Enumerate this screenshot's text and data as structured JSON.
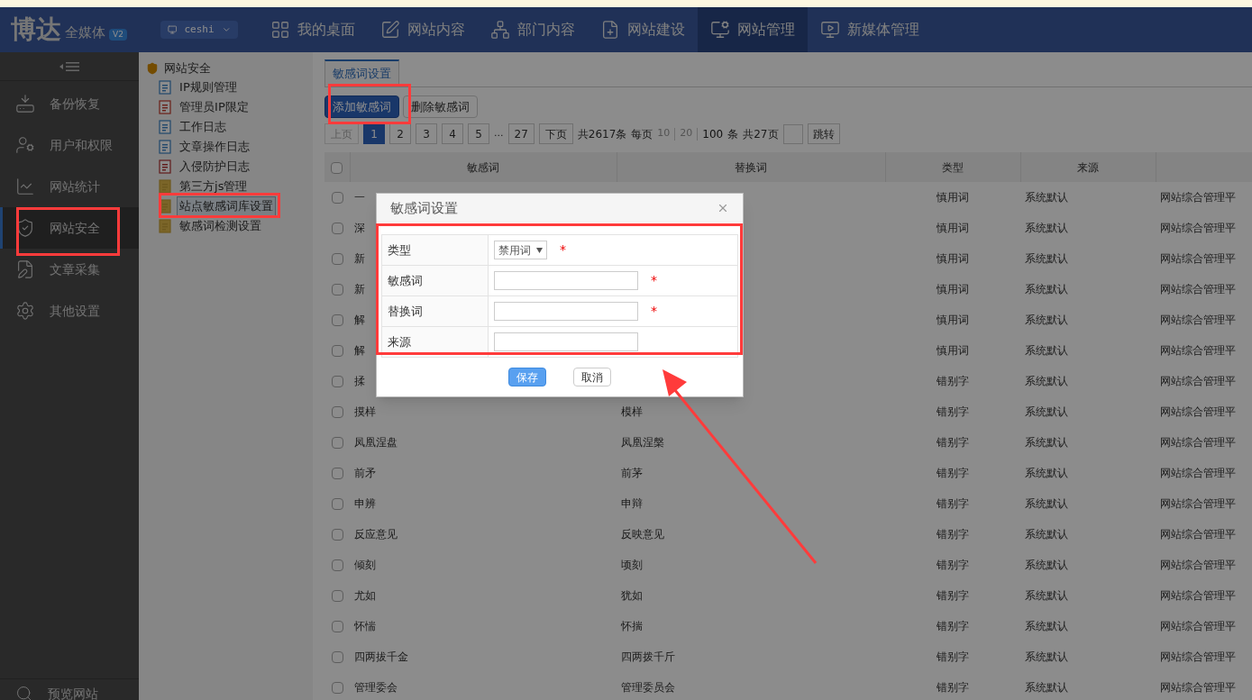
{
  "header": {
    "logo": "博达",
    "logo_sub": "全媒体",
    "version": "V2",
    "site_selector": "ceshi",
    "nav": [
      {
        "label": "我的桌面",
        "selected": false
      },
      {
        "label": "网站内容",
        "selected": false
      },
      {
        "label": "部门内容",
        "selected": false
      },
      {
        "label": "网站建设",
        "selected": false
      },
      {
        "label": "网站管理",
        "selected": true
      },
      {
        "label": "新媒体管理",
        "selected": false
      }
    ]
  },
  "sidebar": {
    "items": [
      {
        "label": "备份恢复",
        "selected": false
      },
      {
        "label": "用户和权限",
        "selected": false
      },
      {
        "label": "网站统计",
        "selected": false
      },
      {
        "label": "网站安全",
        "selected": true
      },
      {
        "label": "文章采集",
        "selected": false
      },
      {
        "label": "其他设置",
        "selected": false
      }
    ],
    "bottom_item": "预览网站"
  },
  "tree": {
    "label": "网站安全",
    "children": [
      {
        "label": "IP规则管理",
        "selected": false
      },
      {
        "label": "管理员IP限定",
        "selected": false
      },
      {
        "label": "工作日志",
        "selected": false
      },
      {
        "label": "文章操作日志",
        "selected": false
      },
      {
        "label": "入侵防护日志",
        "selected": false
      },
      {
        "label": "第三方js管理",
        "selected": false
      },
      {
        "label": "站点敏感词库设置",
        "selected": true
      },
      {
        "label": "敏感词检测设置",
        "selected": false
      }
    ]
  },
  "tabs": [
    {
      "label": "敏感词设置",
      "selected": true
    }
  ],
  "toolbar": [
    {
      "label": "添加敏感词",
      "kind": "primary"
    },
    {
      "label": "删除敏感词",
      "kind": "default"
    }
  ],
  "pagination": {
    "items": [
      {
        "label": "上页",
        "kind": "prev",
        "disabled": true
      },
      {
        "label": "1",
        "kind": "page",
        "selected": true
      },
      {
        "label": "2",
        "kind": "page",
        "selected": false
      },
      {
        "label": "3",
        "kind": "page",
        "selected": false
      },
      {
        "label": "4",
        "kind": "page",
        "selected": false
      },
      {
        "label": "5",
        "kind": "page",
        "selected": false
      },
      {
        "label": "...",
        "kind": "ellipsis"
      },
      {
        "label": "27",
        "kind": "page",
        "selected": false
      },
      {
        "label": "下页",
        "kind": "next",
        "disabled": false
      }
    ],
    "total": "共2617条",
    "per_page_label": "每页",
    "sizes": [
      {
        "label": "10",
        "selected": false
      },
      {
        "label": "20",
        "selected": false
      },
      {
        "label": "100",
        "selected": true
      }
    ],
    "unit": "条",
    "pages": "共27页",
    "jump": "跳转"
  },
  "table": {
    "all_checked": false,
    "columns": [
      "敏感词",
      "替换词",
      "类型",
      "来源"
    ],
    "rows": [
      {
        "checked": false,
        "word": "一",
        "type": "慎用词",
        "source": "系统默认",
        "column_6": "网站综合管理平"
      },
      {
        "checked": false,
        "word": "深",
        "type": "慎用词",
        "source": "系统默认",
        "column_6": "网站综合管理平"
      },
      {
        "checked": false,
        "word": "新",
        "type": "慎用词",
        "source": "系统默认",
        "column_6": "网站综合管理平"
      },
      {
        "checked": false,
        "word": "新",
        "type": "慎用词",
        "source": "系统默认",
        "column_6": "网站综合管理平"
      },
      {
        "checked": false,
        "word": "解",
        "type": "慎用词",
        "source": "系统默认",
        "column_6": "网站综合管理平"
      },
      {
        "checked": false,
        "word": "解",
        "type": "慎用词",
        "source": "系统默认",
        "column_6": "网站综合管理平"
      },
      {
        "checked": false,
        "word": "揉",
        "type": "错别字",
        "source": "系统默认",
        "column_6": "网站综合管理平"
      },
      {
        "checked": false,
        "word": "摸样",
        "replacement": "模样",
        "type": "错别字",
        "source": "系统默认",
        "column_6": "网站综合管理平"
      },
      {
        "checked": false,
        "word": "凤凰涅盘",
        "replacement": "凤凰涅槃",
        "type": "错别字",
        "source": "系统默认",
        "column_6": "网站综合管理平"
      },
      {
        "checked": false,
        "word": "前矛",
        "replacement": "前茅",
        "type": "错别字",
        "source": "系统默认",
        "column_6": "网站综合管理平"
      },
      {
        "checked": false,
        "word": "申辨",
        "replacement": "申辩",
        "type": "错别字",
        "source": "系统默认",
        "column_6": "网站综合管理平"
      },
      {
        "checked": false,
        "word": "反应意见",
        "replacement": "反映意见",
        "type": "错别字",
        "source": "系统默认",
        "column_6": "网站综合管理平"
      },
      {
        "checked": false,
        "word": "倾刻",
        "replacement": "顷刻",
        "type": "错别字",
        "source": "系统默认",
        "column_6": "网站综合管理平"
      },
      {
        "checked": false,
        "word": "尤如",
        "replacement": "犹如",
        "type": "错别字",
        "source": "系统默认",
        "column_6": "网站综合管理平"
      },
      {
        "checked": false,
        "word": "怀惴",
        "replacement": "怀揣",
        "type": "错别字",
        "source": "系统默认",
        "column_6": "网站综合管理平"
      },
      {
        "checked": false,
        "word": "四两拔千金",
        "replacement": "四两拨千斤",
        "type": "错别字",
        "source": "系统默认",
        "column_6": "网站综合管理平"
      },
      {
        "checked": false,
        "word": "管理委会",
        "replacement": "管理委员会",
        "type": "错别字",
        "source": "系统默认",
        "column_6": "网站综合管理平"
      }
    ]
  },
  "dialog": {
    "title": "敏感词设置",
    "fields": [
      {
        "label": "类型",
        "kind": "select",
        "value": "禁用词",
        "required_mark": "*"
      },
      {
        "label": "敏感词",
        "kind": "text",
        "required_mark": "*"
      },
      {
        "label": "替换词",
        "kind": "text",
        "required_mark": "*"
      },
      {
        "label": "来源",
        "kind": "text"
      }
    ],
    "buttons": [
      {
        "label": "保存",
        "kind": "primary"
      },
      {
        "label": "取消",
        "kind": "default"
      }
    ]
  }
}
